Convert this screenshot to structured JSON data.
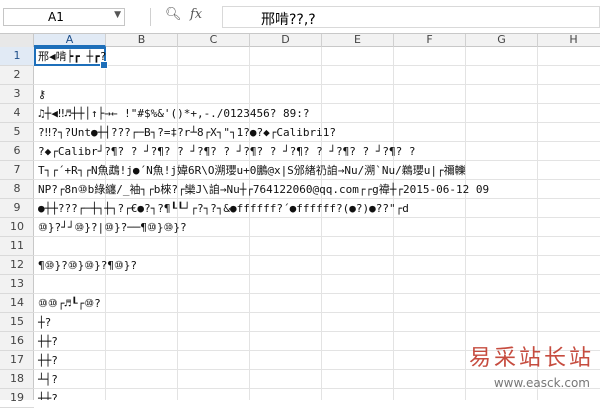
{
  "formula_bar": {
    "cell_ref": "A1",
    "zoom_icon": "magnifier-icon",
    "fx_label": "fx",
    "formula_value": "邢啃??,?"
  },
  "columns": [
    "A",
    "B",
    "C",
    "D",
    "E",
    "F",
    "G",
    "H"
  ],
  "rows": [
    "1",
    "2",
    "3",
    "4",
    "5",
    "6",
    "7",
    "8",
    "9",
    "10",
    "11",
    "12",
    "13",
    "14",
    "15",
    "16",
    "17",
    "18",
    "19"
  ],
  "cells": [
    {
      "row": 1,
      "text": "   邢◀啃┝┏          ┼┏?"
    },
    {
      "row": 3,
      "text": "⚷"
    },
    {
      "row": 4,
      "text": "♫┼◀‼♬┼┼│↑├→← !\"#$%&'()*+,-./0123456?     89:?"
    },
    {
      "row": 5,
      "text": "?‼?┐?Unt●┼┤???┌─B┐?=‡?r┴8┌X┐\"┐1?●?◆┌Calibri1?"
    },
    {
      "row": 6,
      "text": "?◆┌Calibr┘?¶? ?   ┘?¶? ?   ┘?¶? ?   ┘?¶? ?   ┘?¶? ?   ┘?¶? ?   ┘?¶? ?"
    },
    {
      "row": 7,
      "text": "T┐┌´+R┐┌N魚鵡!j●´N魚!j媁6R\\O溯瓔u+0鵬@x|S邠緖礽詯→Nu/溯`Nu/鵜瓔u|┌禰轢"
    },
    {
      "row": 8,
      "text": "NP?┌8n⑩b綠纏/_袖┐┌b棶?┌欒J\\詯→Nu┼┌764122060@qq.com┌┌g禕┼┌2015-06-12 09"
    },
    {
      "row": 9,
      "text": "         ●┼┼???┌─┼┐┼┐?┌€●?┐?¶┖┖┘┌?┐?┐&●ffffff?´●ffffff?(●?)●??\"┌d"
    },
    {
      "row": 10,
      "text": "⑩}?┘┘⑩}?|⑩}?──¶⑩}⑩}?"
    },
    {
      "row": 12,
      "text": "¶⑩}?⑩}⑩}?¶⑩}?"
    },
    {
      "row": 14,
      "text": "⑩⑩┌♬┖┌⑩?"
    },
    {
      "row": 15,
      "text": "┼?"
    },
    {
      "row": 16,
      "text": "┼┼?"
    },
    {
      "row": 17,
      "text": "┼┼?"
    },
    {
      "row": 18,
      "text": "┴┤?"
    },
    {
      "row": 19,
      "text": "┼┼?"
    }
  ],
  "watermark": {
    "text": "易采站长站",
    "url": "www.easck.com"
  },
  "colors": {
    "accent": "#1d6fba",
    "watermark": "#c0392b"
  }
}
